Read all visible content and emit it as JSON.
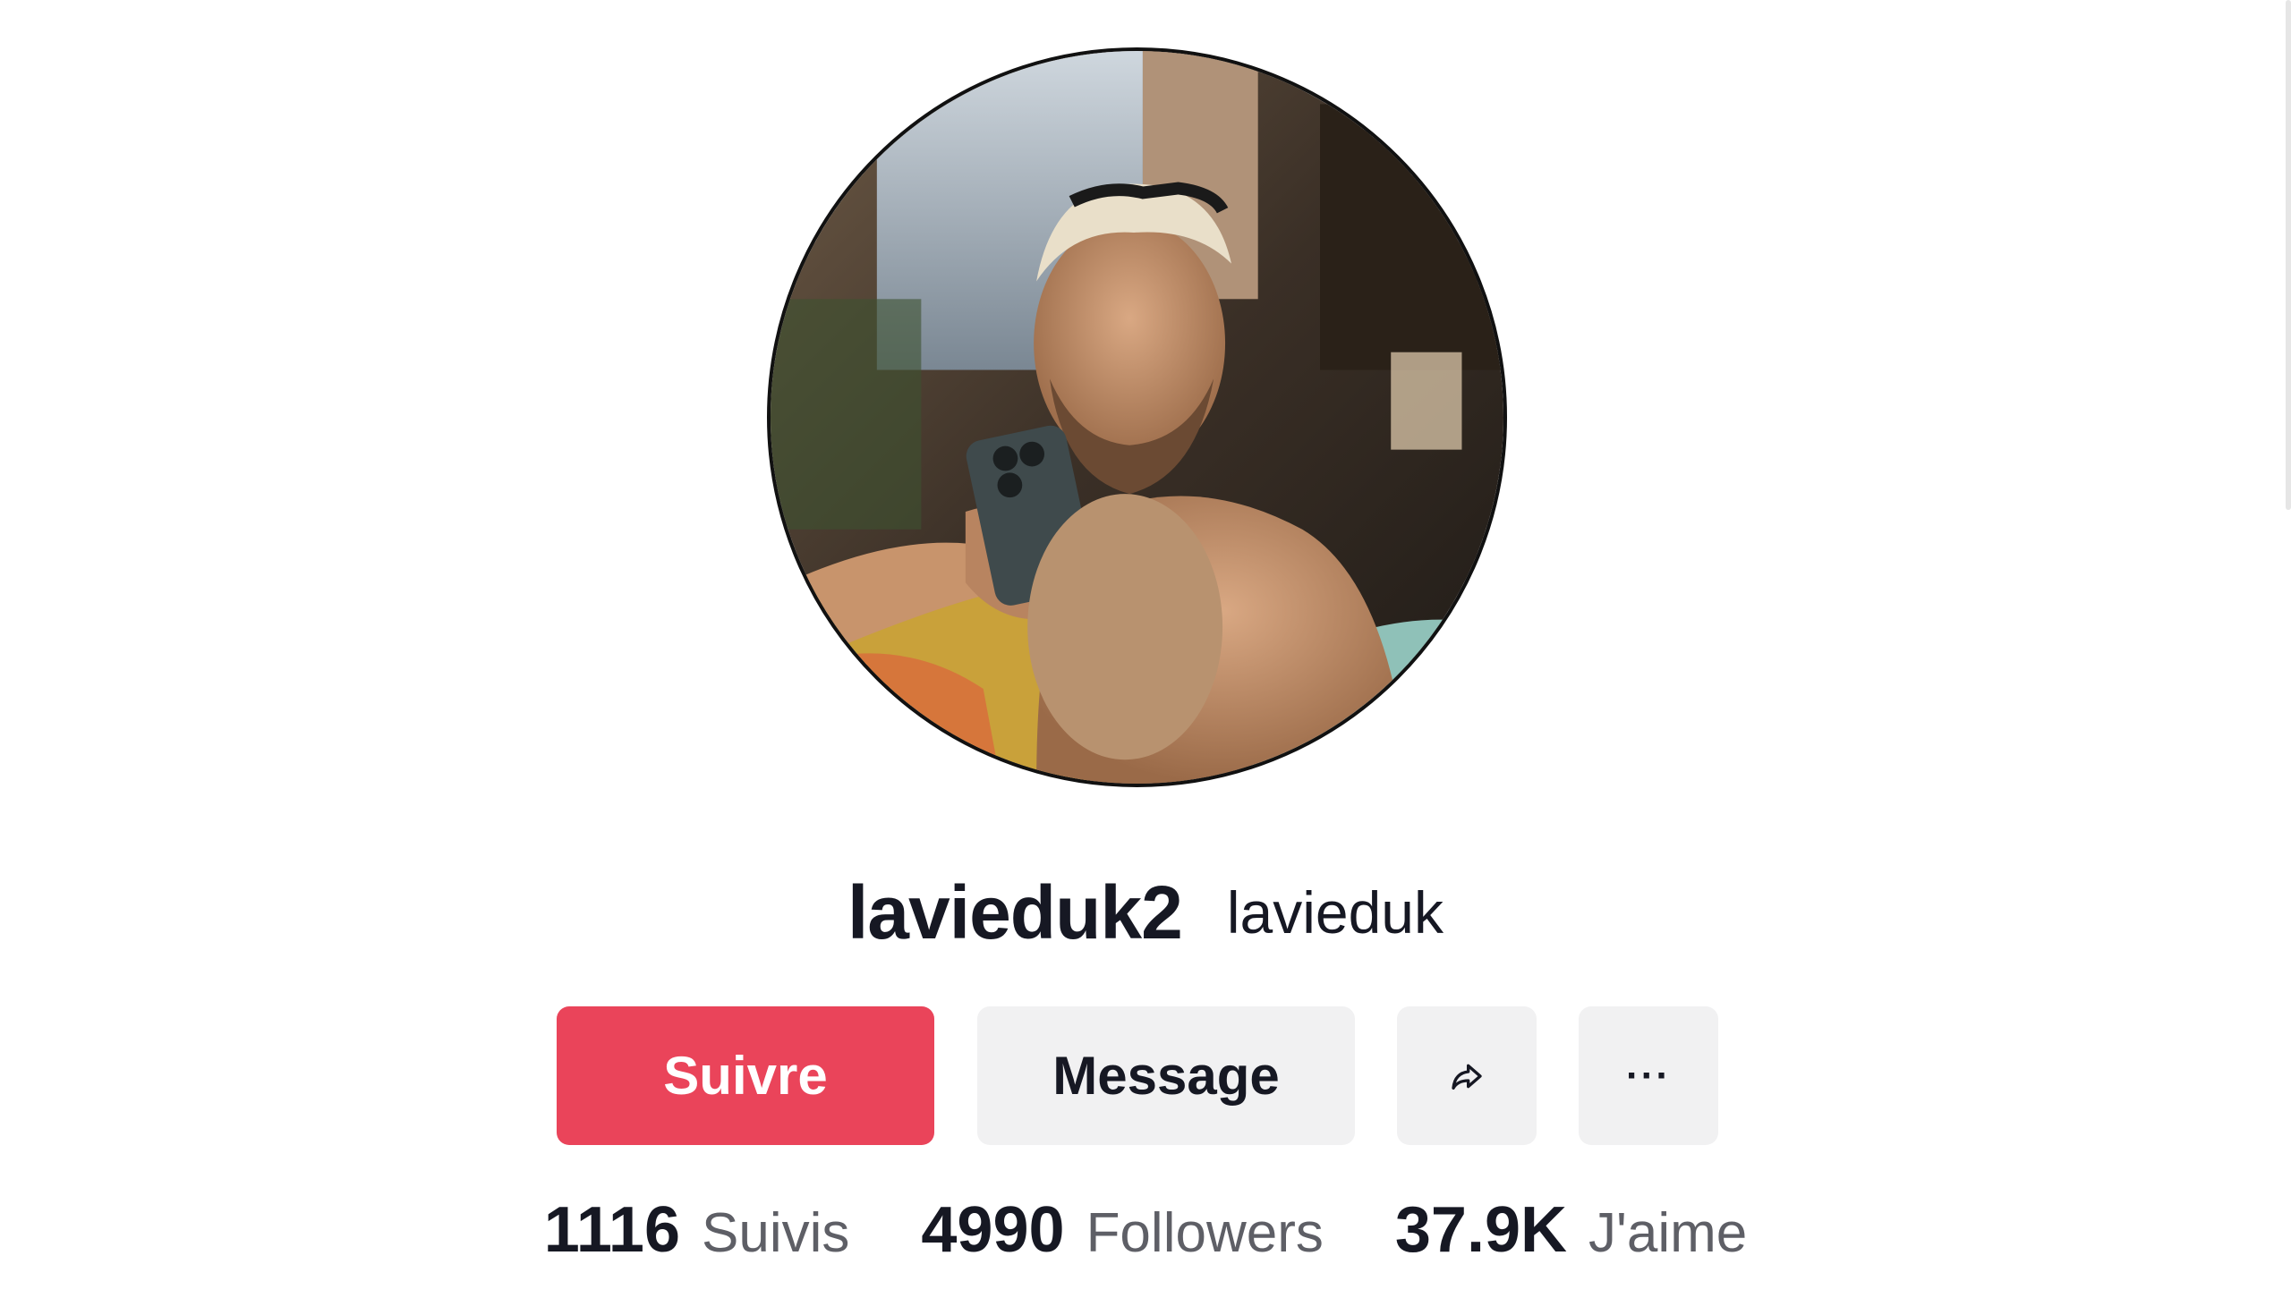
{
  "profile": {
    "username": "lavieduk2",
    "nickname": "lavieduk",
    "avatar_icon": "profile-photo"
  },
  "actions": {
    "follow_label": "Suivre",
    "message_label": "Message",
    "share_icon": "share-arrow-icon",
    "more_label": "···"
  },
  "stats": [
    {
      "value": "1116",
      "label": "Suivis"
    },
    {
      "value": "4990",
      "label": "Followers"
    },
    {
      "value": "37.9K",
      "label": "J'aime"
    }
  ],
  "colors": {
    "follow_bg": "#ea445a",
    "secondary_bg": "#f1f1f2",
    "text_primary": "#161823",
    "text_secondary": "#5e5f66"
  }
}
